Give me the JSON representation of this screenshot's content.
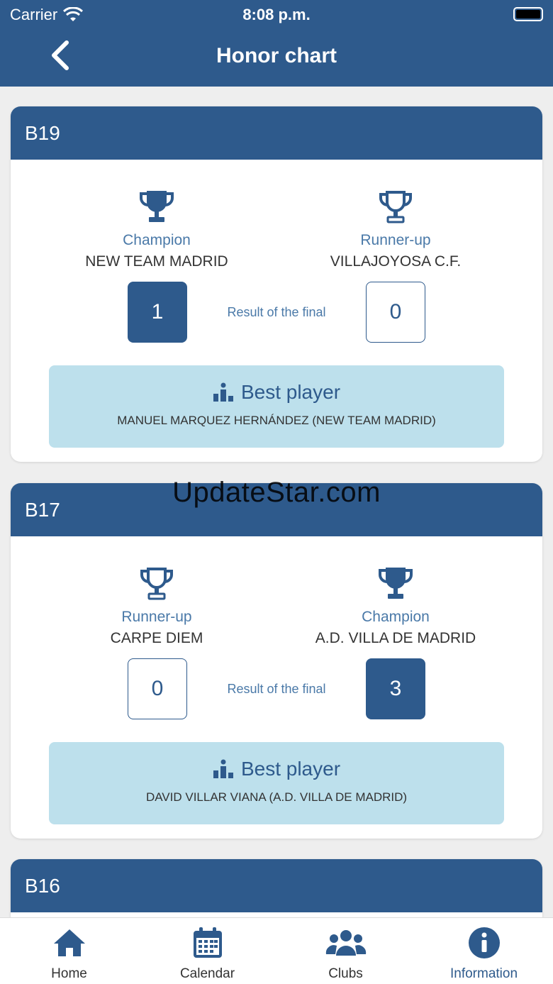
{
  "status": {
    "carrier": "Carrier",
    "time": "8:08 p.m."
  },
  "header": {
    "title": "Honor chart"
  },
  "colors": {
    "primary": "#2e5a8c",
    "accent_light": "#bde0ec",
    "text_blue": "#4a79a8"
  },
  "cards": [
    {
      "category": "B19",
      "left": {
        "role": "Champion",
        "team": "NEW TEAM MADRID",
        "score": "1",
        "winner": true
      },
      "right": {
        "role": "Runner-up",
        "team": "VILLAJOYOSA C.F.",
        "score": "0",
        "winner": false
      },
      "result_label": "Result of the final",
      "best_player_title": "Best player",
      "best_player": "MANUEL MARQUEZ HERNÁNDEZ (NEW TEAM MADRID)"
    },
    {
      "category": "B17",
      "left": {
        "role": "Runner-up",
        "team": "CARPE DIEM",
        "score": "0",
        "winner": false
      },
      "right": {
        "role": "Champion",
        "team": "A.D. VILLA DE MADRID",
        "score": "3",
        "winner": true
      },
      "result_label": "Result of the final",
      "best_player_title": "Best player",
      "best_player": "DAVID VILLAR VIANA (A.D. VILLA DE MADRID)"
    },
    {
      "category": "B16"
    }
  ],
  "watermark": "UpdateStar.com",
  "tabbar": {
    "items": [
      {
        "label": "Home",
        "icon": "home-icon"
      },
      {
        "label": "Calendar",
        "icon": "calendar-icon"
      },
      {
        "label": "Clubs",
        "icon": "clubs-icon"
      },
      {
        "label": "Information",
        "icon": "info-icon",
        "active": true
      }
    ]
  }
}
